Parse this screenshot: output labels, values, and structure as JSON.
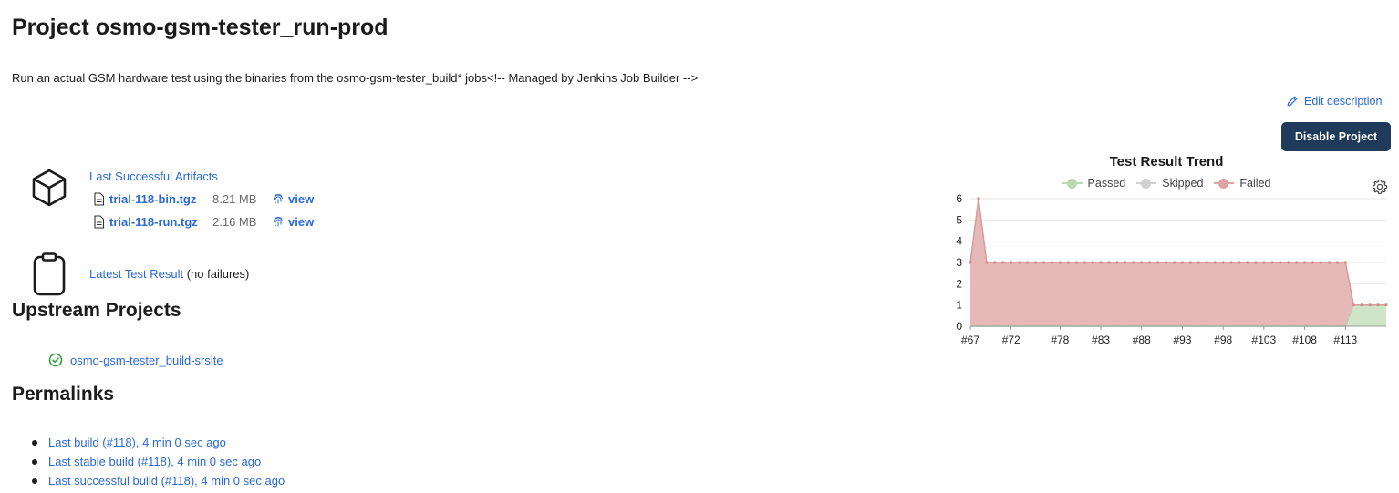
{
  "page": {
    "title": "Project osmo-gsm-tester_run-prod",
    "description": "Run an actual GSM hardware test using the binaries from the osmo-gsm-tester_build* jobs<!-- Managed by Jenkins Job Builder -->"
  },
  "actions": {
    "edit_description": "Edit description",
    "disable_project": "Disable Project"
  },
  "artifacts": {
    "title": "Last Successful Artifacts",
    "files": [
      {
        "name": "trial-118-bin.tgz",
        "size": "8.21 MB",
        "view": "view"
      },
      {
        "name": "trial-118-run.tgz",
        "size": "2.16 MB",
        "view": "view"
      }
    ]
  },
  "test_result": {
    "link": "Latest Test Result",
    "status": "(no failures)"
  },
  "upstream": {
    "heading": "Upstream Projects",
    "items": [
      {
        "name": "osmo-gsm-tester_build-srslte",
        "status": "success"
      }
    ]
  },
  "permalinks": {
    "heading": "Permalinks",
    "items": [
      "Last build (#118), 4 min 0 sec ago",
      "Last stable build (#118), 4 min 0 sec ago",
      "Last successful build (#118), 4 min 0 sec ago"
    ]
  },
  "icons": {
    "artifacts": "package-icon",
    "test_result": "clipboard-icon",
    "edit": "pencil-icon",
    "file": "file-icon",
    "fingerprint": "fingerprint-icon",
    "status": "check-circle-icon",
    "settings": "gear-icon"
  },
  "colors": {
    "link": "#2b6ad4",
    "button_bg": "#1f3a5a",
    "passed": "#9fce94",
    "skipped": "#c8c8c8",
    "failed": "#d98f8f",
    "success": "#2e9a3a"
  },
  "chart_data": {
    "type": "area",
    "title": "Test Result Trend",
    "legend": [
      "Passed",
      "Skipped",
      "Failed"
    ],
    "legend_position": "top-center",
    "x": [
      "#67",
      "#68",
      "#69",
      "#70",
      "#71",
      "#72",
      "#73",
      "#74",
      "#75",
      "#76",
      "#77",
      "#78",
      "#79",
      "#80",
      "#81",
      "#82",
      "#83",
      "#84",
      "#85",
      "#86",
      "#87",
      "#88",
      "#89",
      "#90",
      "#91",
      "#92",
      "#93",
      "#94",
      "#95",
      "#96",
      "#97",
      "#98",
      "#99",
      "#100",
      "#101",
      "#102",
      "#103",
      "#104",
      "#105",
      "#106",
      "#107",
      "#108",
      "#109",
      "#110",
      "#111",
      "#112",
      "#113",
      "#114",
      "#115",
      "#116",
      "#117",
      "#118"
    ],
    "x_tick_labels": [
      "#67",
      "#72",
      "#78",
      "#83",
      "#88",
      "#93",
      "#98",
      "#103",
      "#108",
      "#113"
    ],
    "series": [
      {
        "name": "Passed",
        "values": [
          0,
          0,
          0,
          0,
          0,
          0,
          0,
          0,
          0,
          0,
          0,
          0,
          0,
          0,
          0,
          0,
          0,
          0,
          0,
          0,
          0,
          0,
          0,
          0,
          0,
          0,
          0,
          0,
          0,
          0,
          0,
          0,
          0,
          0,
          0,
          0,
          0,
          0,
          0,
          0,
          0,
          0,
          0,
          0,
          0,
          0,
          0,
          1,
          1,
          1,
          1,
          1
        ]
      },
      {
        "name": "Skipped",
        "values": [
          0,
          0,
          0,
          0,
          0,
          0,
          0,
          0,
          0,
          0,
          0,
          0,
          0,
          0,
          0,
          0,
          0,
          0,
          0,
          0,
          0,
          0,
          0,
          0,
          0,
          0,
          0,
          0,
          0,
          0,
          0,
          0,
          0,
          0,
          0,
          0,
          0,
          0,
          0,
          0,
          0,
          0,
          0,
          0,
          0,
          0,
          0,
          0,
          0,
          0,
          0,
          0
        ]
      },
      {
        "name": "Failed",
        "values": [
          3,
          6,
          3,
          3,
          3,
          3,
          3,
          3,
          3,
          3,
          3,
          3,
          3,
          3,
          3,
          3,
          3,
          3,
          3,
          3,
          3,
          3,
          3,
          3,
          3,
          3,
          3,
          3,
          3,
          3,
          3,
          3,
          3,
          3,
          3,
          3,
          3,
          3,
          3,
          3,
          3,
          3,
          3,
          3,
          3,
          3,
          3,
          0,
          0,
          0,
          0,
          0
        ]
      }
    ],
    "stacked": true,
    "ylim": [
      0,
      6
    ],
    "y_ticks": [
      0,
      1,
      2,
      3,
      4,
      5,
      6
    ],
    "grid": true
  }
}
